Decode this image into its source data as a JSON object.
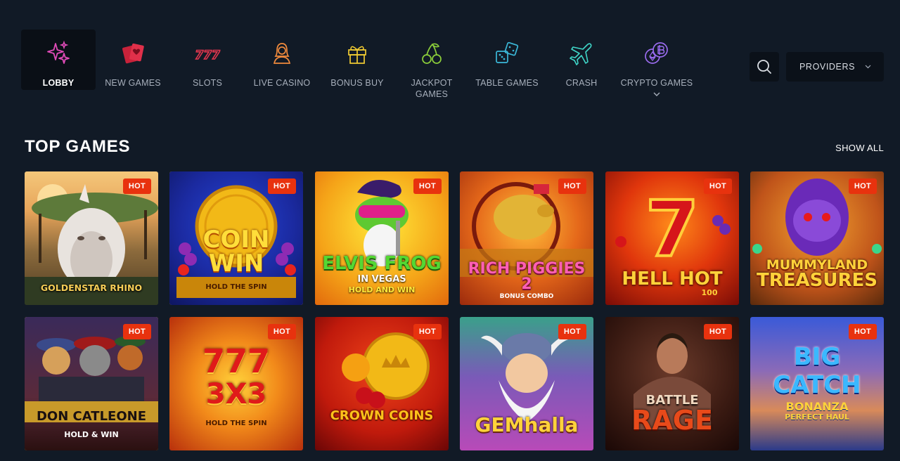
{
  "nav": {
    "items": [
      {
        "label": "LOBBY",
        "icon": "sparkles-icon",
        "active": true
      },
      {
        "label": "NEW GAMES",
        "icon": "cards-icon"
      },
      {
        "label": "SLOTS",
        "icon": "triple-seven-icon"
      },
      {
        "label": "LIVE CASINO",
        "icon": "dealer-icon"
      },
      {
        "label": "BONUS BUY",
        "icon": "gift-icon"
      },
      {
        "label": "JACKPOT GAMES",
        "icon": "cherries-icon"
      },
      {
        "label": "TABLE GAMES",
        "icon": "dice-icon"
      },
      {
        "label": "CRASH",
        "icon": "airplane-icon"
      },
      {
        "label": "CRYPTO GAMES",
        "icon": "crypto-coins-icon"
      }
    ],
    "providers_label": "PROVIDERS"
  },
  "section": {
    "title": "TOP GAMES",
    "show_all": "SHOW ALL"
  },
  "games": [
    {
      "title": "GOLDENSTAR RHINO",
      "badge": "HOT"
    },
    {
      "title": "COIN WIN",
      "subtitle": "HOLD THE SPIN",
      "badge": "HOT"
    },
    {
      "title": "ELVIS FROG",
      "subtitle": "IN VEGAS",
      "subtitle2": "HOLD AND WIN",
      "badge": "HOT"
    },
    {
      "title": "RICH PIGGIES 2",
      "subtitle": "BONUS COMBO",
      "badge": "HOT"
    },
    {
      "title": "HELL HOT",
      "subtitle": "100",
      "badge": "HOT"
    },
    {
      "title": "MUMMYLAND",
      "subtitle": "TREASURES",
      "badge": "HOT"
    },
    {
      "title": "DON CATLEONE",
      "subtitle": "HOLD & WIN",
      "badge": "HOT"
    },
    {
      "title": "777",
      "subtitle": "3X3",
      "subtitle2": "HOLD THE SPIN",
      "badge": "HOT"
    },
    {
      "title": "CROWN COINS",
      "badge": "HOT"
    },
    {
      "title": "GEMhalla",
      "badge": "HOT"
    },
    {
      "title": "BATTLE",
      "subtitle": "RAGE",
      "badge": "HOT"
    },
    {
      "title": "BIG",
      "subtitle": "CATCH",
      "subtitle2": "BONANZA",
      "subtitle3": "PERFECT HAUL",
      "badge": "HOT"
    }
  ]
}
